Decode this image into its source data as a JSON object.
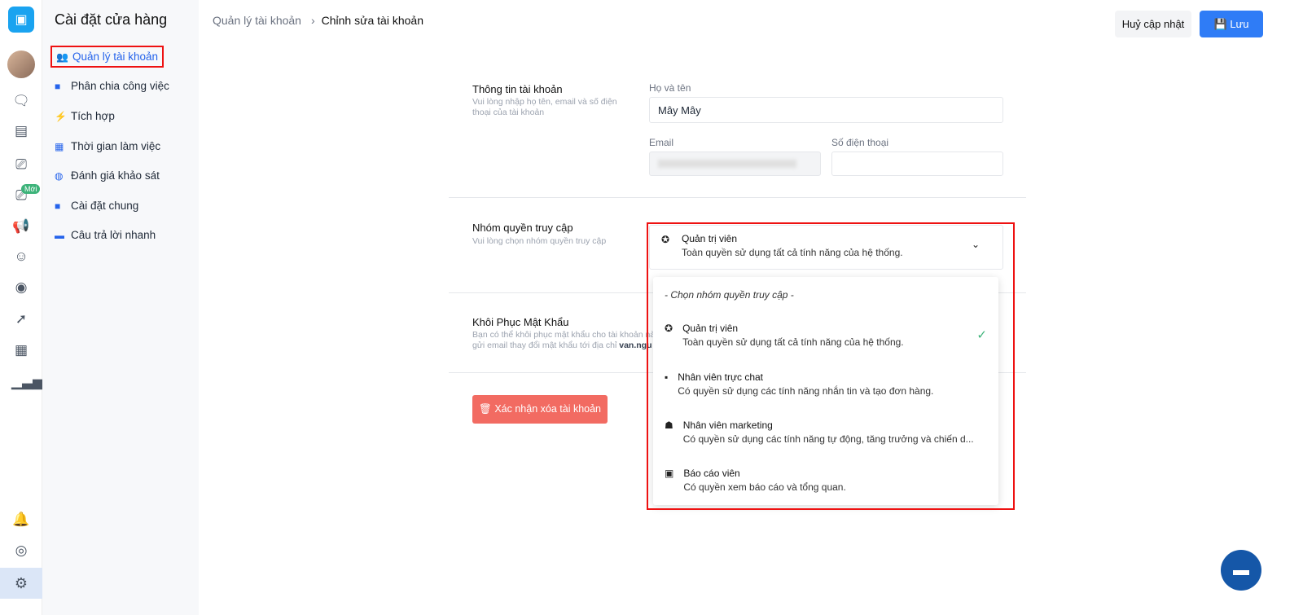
{
  "sidebar": {
    "title": "Cài đặt cửa hàng",
    "items": [
      {
        "label": "Quản lý tài khoản",
        "icon": "users-icon"
      },
      {
        "label": "Phân chia công việc",
        "icon": "badge-icon"
      },
      {
        "label": "Tích hợp",
        "icon": "plug-icon"
      },
      {
        "label": "Thời gian làm việc",
        "icon": "calendar-icon"
      },
      {
        "label": "Đánh giá khảo sát",
        "icon": "survey-icon"
      },
      {
        "label": "Cài đặt chung",
        "icon": "folder-gear-icon"
      },
      {
        "label": "Câu trả lời nhanh",
        "icon": "message-icon"
      }
    ]
  },
  "rail": {
    "new_badge": "Mới"
  },
  "header": {
    "breadcrumb_parent": "Quản lý tài khoản",
    "breadcrumb_current": "Chỉnh sửa tài khoản",
    "cancel_label": "Huỷ cập nhật",
    "save_label": "Lưu"
  },
  "account": {
    "title": "Thông tin tài khoản",
    "hint": "Vui lòng nhập họ tên, email và số điện thoại của tài khoản",
    "name_label": "Họ và tên",
    "name_value": "Mây Mây",
    "email_label": "Email",
    "phone_label": "Số điện thoại"
  },
  "role": {
    "title": "Nhóm quyền truy cập",
    "hint": "Vui lòng chọn nhóm quyền truy cập",
    "selected_title": "Quản trị viên",
    "selected_desc": "Toàn quyền sử dụng tất cả tính năng của hệ thống.",
    "placeholder": "- Chọn nhóm quyền truy cập -",
    "options": [
      {
        "title": "Quản trị viên",
        "desc": "Toàn quyền sử dụng tất cả tính năng của hệ thống.",
        "selected": true
      },
      {
        "title": "Nhân viên trực chat",
        "desc": "Có quyền sử dụng các tính năng nhắn tin và tạo đơn hàng."
      },
      {
        "title": "Nhân viên marketing",
        "desc": "Có quyền sử dụng các tính năng tự động, tăng trưởng và chiến d..."
      },
      {
        "title": "Báo cáo viên",
        "desc": "Có quyền xem báo cáo và tổng quan."
      }
    ]
  },
  "password": {
    "title": "Khôi Phục Mật Khẩu",
    "hint1": "Bạn có thể khôi phục mật khẩu cho tài khoản nà",
    "hint2": "gửi email thay đổi mật khẩu tới địa chỉ ",
    "email_bold": "van.ngu"
  },
  "delete_label": "Xác nhận xóa tài khoản",
  "colors": {
    "primary": "#2f7cf6",
    "danger": "#f26b62",
    "success": "#3db37a"
  }
}
